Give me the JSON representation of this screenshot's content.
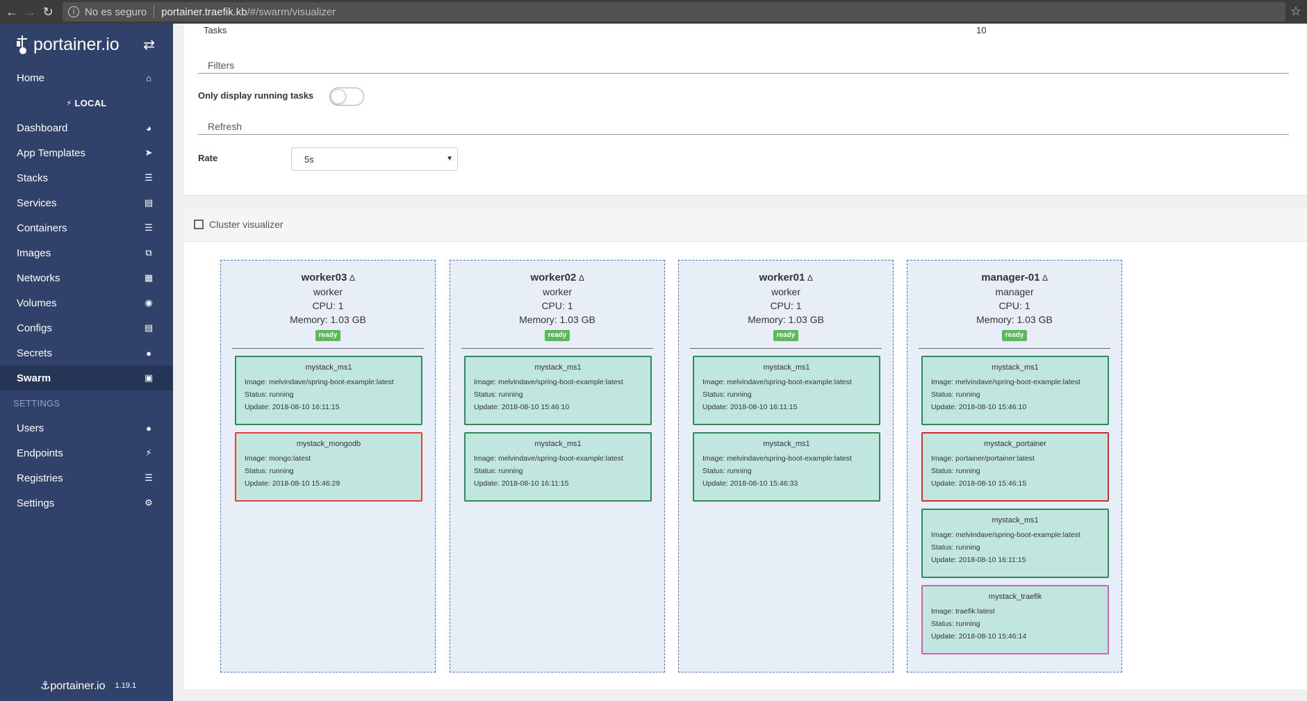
{
  "browser": {
    "security_label": "No es seguro",
    "host": "portainer.traefik.kb",
    "path": "/#/swarm/visualizer"
  },
  "sidebar": {
    "brand": "portainer.io",
    "endpoint": "LOCAL",
    "items": [
      {
        "label": "Home",
        "icon": "home-icon"
      },
      {
        "label": "Dashboard",
        "icon": "dashboard-icon"
      },
      {
        "label": "App Templates",
        "icon": "rocket-icon"
      },
      {
        "label": "Stacks",
        "icon": "th-list-icon"
      },
      {
        "label": "Services",
        "icon": "list-alt-icon"
      },
      {
        "label": "Containers",
        "icon": "server-icon"
      },
      {
        "label": "Images",
        "icon": "clone-icon"
      },
      {
        "label": "Networks",
        "icon": "sitemap-icon"
      },
      {
        "label": "Volumes",
        "icon": "cubes-icon"
      },
      {
        "label": "Configs",
        "icon": "file-code-icon"
      },
      {
        "label": "Secrets",
        "icon": "user-secret-icon"
      },
      {
        "label": "Swarm",
        "icon": "object-group-icon"
      }
    ],
    "settings_heading": "SETTINGS",
    "settings_items": [
      {
        "label": "Users",
        "icon": "users-icon"
      },
      {
        "label": "Endpoints",
        "icon": "plug-icon"
      },
      {
        "label": "Registries",
        "icon": "database-icon"
      },
      {
        "label": "Settings",
        "icon": "cogs-icon"
      }
    ],
    "footer_brand": "portainer.io",
    "version": "1.19.1"
  },
  "info": {
    "tasks_label": "Tasks",
    "tasks_value": "10"
  },
  "filters": {
    "legend": "Filters",
    "running_label": "Only display running tasks",
    "running_on": false
  },
  "refresh": {
    "legend": "Refresh",
    "rate_label": "Rate",
    "rate_value": "5s"
  },
  "visualizer": {
    "title": "Cluster visualizer",
    "nodes": [
      {
        "name": "worker03",
        "role": "worker",
        "cpu": "CPU: 1",
        "memory": "Memory: 1.03 GB",
        "status": "ready",
        "tasks": [
          {
            "name": "mystack_ms1",
            "image": "Image: melvindave/spring-boot-example:latest",
            "status": "Status: running",
            "update": "Update: 2018-08-10 16:11:15",
            "border": "green"
          },
          {
            "name": "mystack_mongodb",
            "image": "Image: mongo:latest",
            "status": "Status: running",
            "update": "Update: 2018-08-10 15:46:29",
            "border": "red"
          }
        ]
      },
      {
        "name": "worker02",
        "role": "worker",
        "cpu": "CPU: 1",
        "memory": "Memory: 1.03 GB",
        "status": "ready",
        "tasks": [
          {
            "name": "mystack_ms1",
            "image": "Image: melvindave/spring-boot-example:latest",
            "status": "Status: running",
            "update": "Update: 2018-08-10 15:46:10",
            "border": "green"
          },
          {
            "name": "mystack_ms1",
            "image": "Image: melvindave/spring-boot-example:latest",
            "status": "Status: running",
            "update": "Update: 2018-08-10 16:11:15",
            "border": "green"
          }
        ]
      },
      {
        "name": "worker01",
        "role": "worker",
        "cpu": "CPU: 1",
        "memory": "Memory: 1.03 GB",
        "status": "ready",
        "tasks": [
          {
            "name": "mystack_ms1",
            "image": "Image: melvindave/spring-boot-example:latest",
            "status": "Status: running",
            "update": "Update: 2018-08-10 16:11:15",
            "border": "green"
          },
          {
            "name": "mystack_ms1",
            "image": "Image: melvindave/spring-boot-example:latest",
            "status": "Status: running",
            "update": "Update: 2018-08-10 15:46:33",
            "border": "green"
          }
        ]
      },
      {
        "name": "manager-01",
        "role": "manager",
        "cpu": "CPU: 1",
        "memory": "Memory: 1.03 GB",
        "status": "ready",
        "tasks": [
          {
            "name": "mystack_ms1",
            "image": "Image: melvindave/spring-boot-example:latest",
            "status": "Status: running",
            "update": "Update: 2018-08-10 15:46:10",
            "border": "green"
          },
          {
            "name": "mystack_portainer",
            "image": "Image: portainer/portainer:latest",
            "status": "Status: running",
            "update": "Update: 2018-08-10 15:46:15",
            "border": "darkred"
          },
          {
            "name": "mystack_ms1",
            "image": "Image: melvindave/spring-boot-example:latest",
            "status": "Status: running",
            "update": "Update: 2018-08-10 16:11:15",
            "border": "green"
          },
          {
            "name": "mystack_traefik",
            "image": "Image: traefik:latest",
            "status": "Status: running",
            "update": "Update: 2018-08-10 15:46:14",
            "border": "pink"
          }
        ]
      }
    ]
  },
  "colors": {
    "sidebar_bg": "#30426a",
    "sidebar_active": "#253556",
    "ready_badge": "#5cb85c",
    "task_bg": "#c0e6df",
    "node_border": "#4a78c4"
  }
}
